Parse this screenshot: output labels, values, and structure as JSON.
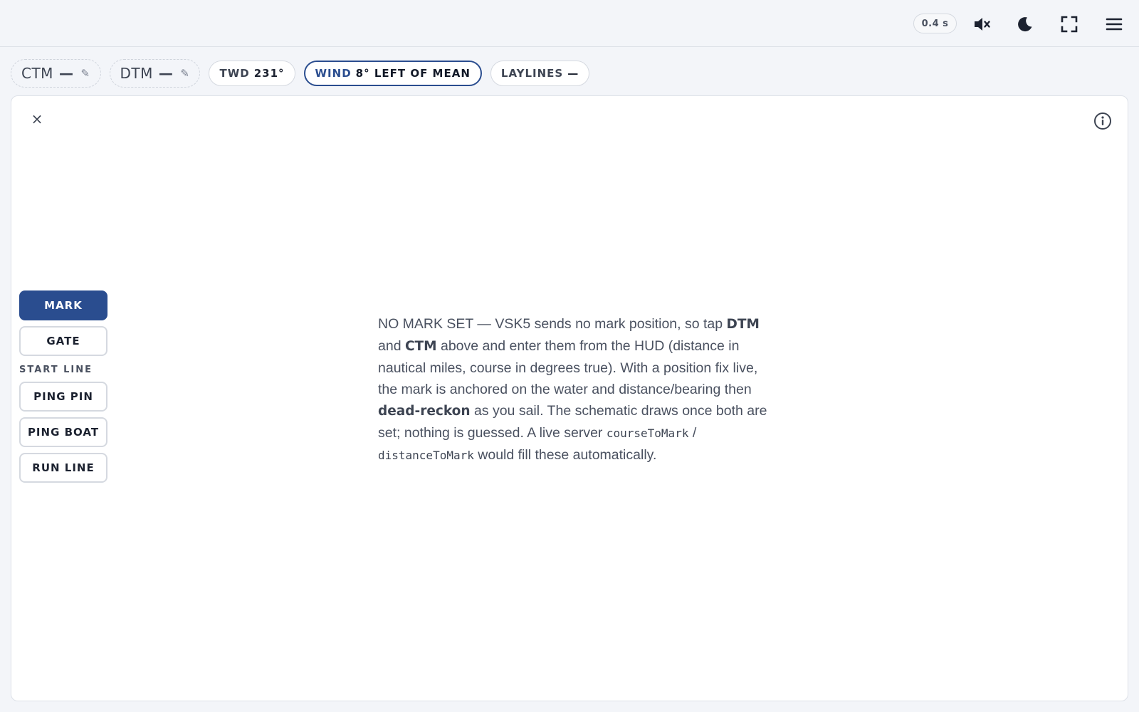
{
  "topbar": {
    "latency": "0.4 s",
    "icons": {
      "mute": "speaker-muted-icon",
      "theme": "moon-icon",
      "fullscreen": "fullscreen-icon",
      "menu": "hamburger-menu-icon"
    }
  },
  "chips": {
    "ctm": {
      "label": "CTM",
      "value": "—"
    },
    "dtm": {
      "label": "DTM",
      "value": "—"
    },
    "twd": {
      "label": "TWD",
      "value": "231°"
    },
    "wind": {
      "label": "WIND",
      "value": "8° LEFT OF MEAN"
    },
    "laylines": {
      "label": "LAYLINES",
      "value": "—"
    }
  },
  "panel": {
    "close": "×",
    "sidebar": {
      "mark": "MARK",
      "gate": "GATE",
      "start_line_heading": "START LINE",
      "ping_pin": "PING PIN",
      "ping_boat": "PING BOAT",
      "run_line": "RUN LINE"
    },
    "message": {
      "p1": "NO MARK SET — VSK5 sends no mark position, so tap ",
      "dtm": "DTM",
      "p2": " and ",
      "ctm": "CTM",
      "p3": " above and enter them from the HUD (distance in nautical miles, course in degrees true). With a position fix live, the mark is anchored on the water and distance/bearing then ",
      "dead_reckon": "dead-reckon",
      "p4": " as you sail. The schematic draws once both are set; nothing is guessed. A live server ",
      "code1": "courseToMark",
      "p5": " / ",
      "code2": "distanceToMark",
      "p6": " would fill these automatically."
    }
  },
  "colors": {
    "accent": "#2a4d8f",
    "background": "#f3f5f9",
    "panel": "#ffffff"
  }
}
